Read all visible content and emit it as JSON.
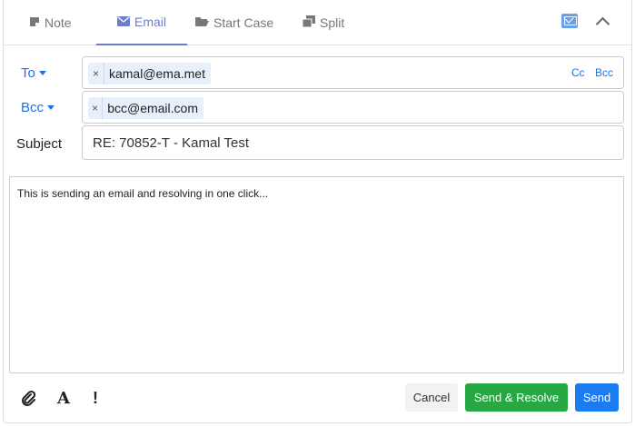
{
  "tabs": {
    "note": "Note",
    "email": "Email",
    "start_case": "Start Case",
    "split": "Split",
    "active": "Email"
  },
  "icons": [
    "note-icon",
    "envelope-icon",
    "folder-icon",
    "split-icon",
    "envelope-blue-icon",
    "chevron-up-icon",
    "paperclip-icon",
    "font-icon",
    "priority-icon"
  ],
  "compose": {
    "to_label": "To",
    "to_chips": [
      "kamal@ema.met"
    ],
    "cc_link": "Cc",
    "bcc_link": "Bcc",
    "bcc_label": "Bcc",
    "bcc_chips": [
      "bcc@email.com"
    ],
    "chip_remove": "×",
    "subject_label": "Subject",
    "subject_value": "RE: 70852-T - Kamal Test",
    "body": "This is sending an email and resolving in one click..."
  },
  "footer": {
    "font_glyph": "A",
    "priority_glyph": "!",
    "cancel": "Cancel",
    "send_resolve": "Send & Resolve",
    "send": "Send"
  },
  "colors": {
    "accent": "#6d7fcc",
    "link": "#1a73e8",
    "resolve": "#28a745",
    "send": "#1a7cf0"
  }
}
